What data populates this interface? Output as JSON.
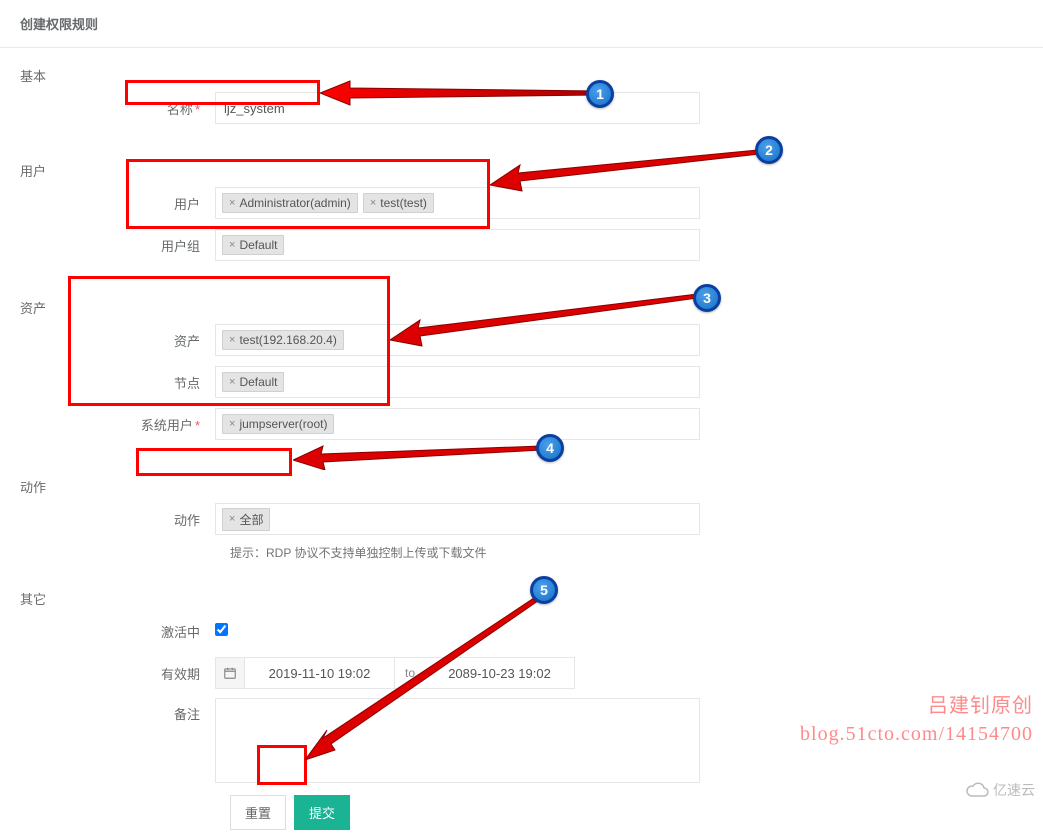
{
  "page_title": "创建权限规则",
  "sections": {
    "basic": {
      "title": "基本"
    },
    "user": {
      "title": "用户"
    },
    "asset": {
      "title": "资产"
    },
    "action": {
      "title": "动作"
    },
    "other": {
      "title": "其它"
    }
  },
  "fields": {
    "name": {
      "label": "名称",
      "value": "ljz_system"
    },
    "users": {
      "label": "用户",
      "tags": [
        "Administrator(admin)",
        "test(test)"
      ]
    },
    "user_groups": {
      "label": "用户组",
      "tags": [
        "Default"
      ]
    },
    "assets": {
      "label": "资产",
      "tags": [
        "test(192.168.20.4)"
      ]
    },
    "nodes": {
      "label": "节点",
      "tags": [
        "Default"
      ]
    },
    "system_users": {
      "label": "系统用户",
      "tags": [
        "jumpserver(root)"
      ]
    },
    "actions": {
      "label": "动作",
      "tags": [
        "全部"
      ]
    },
    "action_help": "提示：RDP 协议不支持单独控制上传或下载文件",
    "active": {
      "label": "激活中",
      "checked": true
    },
    "validity": {
      "label": "有效期",
      "from": "2019-11-10 19:02",
      "sep": "to",
      "to": "2089-10-23 19:02"
    },
    "remark": {
      "label": "备注",
      "value": ""
    }
  },
  "buttons": {
    "reset": "重置",
    "submit": "提交"
  },
  "watermark": {
    "line1": "吕建钊原创",
    "line2": "blog.51cto.com/14154700"
  },
  "cloud_brand": "亿速云",
  "annotations": {
    "badges": [
      "1",
      "2",
      "3",
      "4",
      "5"
    ]
  }
}
